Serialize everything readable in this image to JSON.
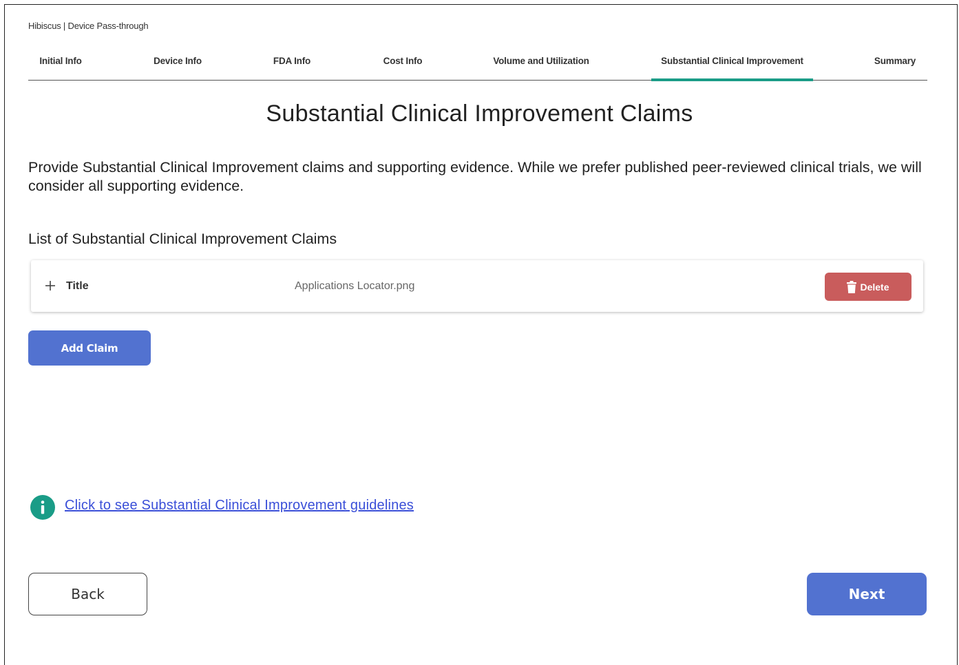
{
  "app": {
    "breadcrumb": "Hibiscus | Device Pass-through"
  },
  "tabs": [
    {
      "label": "Initial Info"
    },
    {
      "label": "Device Info"
    },
    {
      "label": "FDA Info"
    },
    {
      "label": "Cost Info"
    },
    {
      "label": "Volume and Utilization"
    },
    {
      "label": "Substantial Clinical Improvement",
      "active": true
    },
    {
      "label": "Summary"
    }
  ],
  "page": {
    "title": "Substantial Clinical Improvement Claims",
    "intro": "Provide Substantial Clinical Improvement claims and supporting evidence. While we prefer published peer-reviewed clinical trials, we will consider all supporting evidence.",
    "list_heading": "List of Substantial Clinical Improvement Claims"
  },
  "claims": [
    {
      "title": "Title",
      "file": "Applications Locator.png",
      "delete_label": "Delete"
    }
  ],
  "actions": {
    "add_claim": "Add Claim",
    "guidelines_link": "Click to see Substantial Clinical Improvement guidelines",
    "back": "Back",
    "next": "Next"
  },
  "icons": {
    "expand": "plus-icon",
    "delete": "trash-icon",
    "info": "info-icon"
  },
  "colors": {
    "accent_teal": "#1a9c87",
    "primary_blue": "#5272d0",
    "danger_red": "#c95c5c",
    "link_blue": "#3a4fd8"
  }
}
